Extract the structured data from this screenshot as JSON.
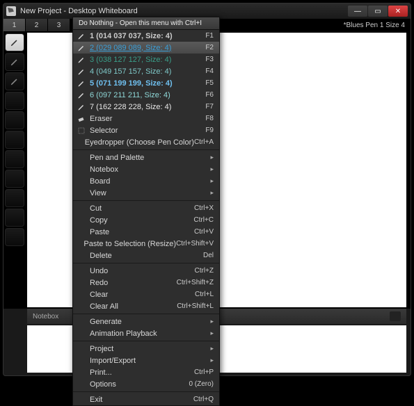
{
  "window": {
    "title": "New Project - Desktop Whiteboard"
  },
  "tabs": {
    "tab1": "1",
    "tab2": "2",
    "tab3": "3"
  },
  "status": {
    "right": "*Blues   Pen 1   Size 4"
  },
  "notebox": {
    "label": "Notebox"
  },
  "menu": {
    "header": "Do Nothing - Open this menu with Ctrl+I",
    "pens": [
      {
        "label": "1 (014 037 037, Size: 4)",
        "shortcut": "F1",
        "cls": "pen1"
      },
      {
        "label": "2 (029 089 089, Size: 4)",
        "shortcut": "F2",
        "cls": "pen2"
      },
      {
        "label": "3 (038 127 127, Size: 4)",
        "shortcut": "F3",
        "cls": "pen3"
      },
      {
        "label": "4 (049 157 157, Size: 4)",
        "shortcut": "F4",
        "cls": "pen4"
      },
      {
        "label": "5 (071 199 199, Size: 4)",
        "shortcut": "F5",
        "cls": "pen5"
      },
      {
        "label": "6 (097 211 211, Size: 4)",
        "shortcut": "F6",
        "cls": "pen6"
      },
      {
        "label": "7 (162 228 228, Size: 4)",
        "shortcut": "F7",
        "cls": "pen7"
      }
    ],
    "eraser": {
      "label": "Eraser",
      "shortcut": "F8"
    },
    "selector": {
      "label": "Selector",
      "shortcut": "F9"
    },
    "eyedropper": {
      "label": "Eyedropper (Choose Pen Color)",
      "shortcut": "Ctrl+A"
    },
    "penpalette": {
      "label": "Pen and Palette"
    },
    "noteboxm": {
      "label": "Notebox"
    },
    "board": {
      "label": "Board"
    },
    "view": {
      "label": "View"
    },
    "cut": {
      "label": "Cut",
      "shortcut": "Ctrl+X"
    },
    "copy": {
      "label": "Copy",
      "shortcut": "Ctrl+C"
    },
    "paste": {
      "label": "Paste",
      "shortcut": "Ctrl+V"
    },
    "pastesel": {
      "label": "Paste to Selection (Resize)",
      "shortcut": "Ctrl+Shift+V"
    },
    "delete": {
      "label": "Delete",
      "shortcut": "Del"
    },
    "undo": {
      "label": "Undo",
      "shortcut": "Ctrl+Z"
    },
    "redo": {
      "label": "Redo",
      "shortcut": "Ctrl+Shift+Z"
    },
    "clear": {
      "label": "Clear",
      "shortcut": "Ctrl+L"
    },
    "clearall": {
      "label": "Clear All",
      "shortcut": "Ctrl+Shift+L"
    },
    "generate": {
      "label": "Generate"
    },
    "anim": {
      "label": "Animation Playback"
    },
    "project": {
      "label": "Project"
    },
    "impexp": {
      "label": "Import/Export"
    },
    "print": {
      "label": "Print...",
      "shortcut": "Ctrl+P"
    },
    "options": {
      "label": "Options",
      "shortcut": "0 (Zero)"
    },
    "exit": {
      "label": "Exit",
      "shortcut": "Ctrl+Q"
    }
  }
}
